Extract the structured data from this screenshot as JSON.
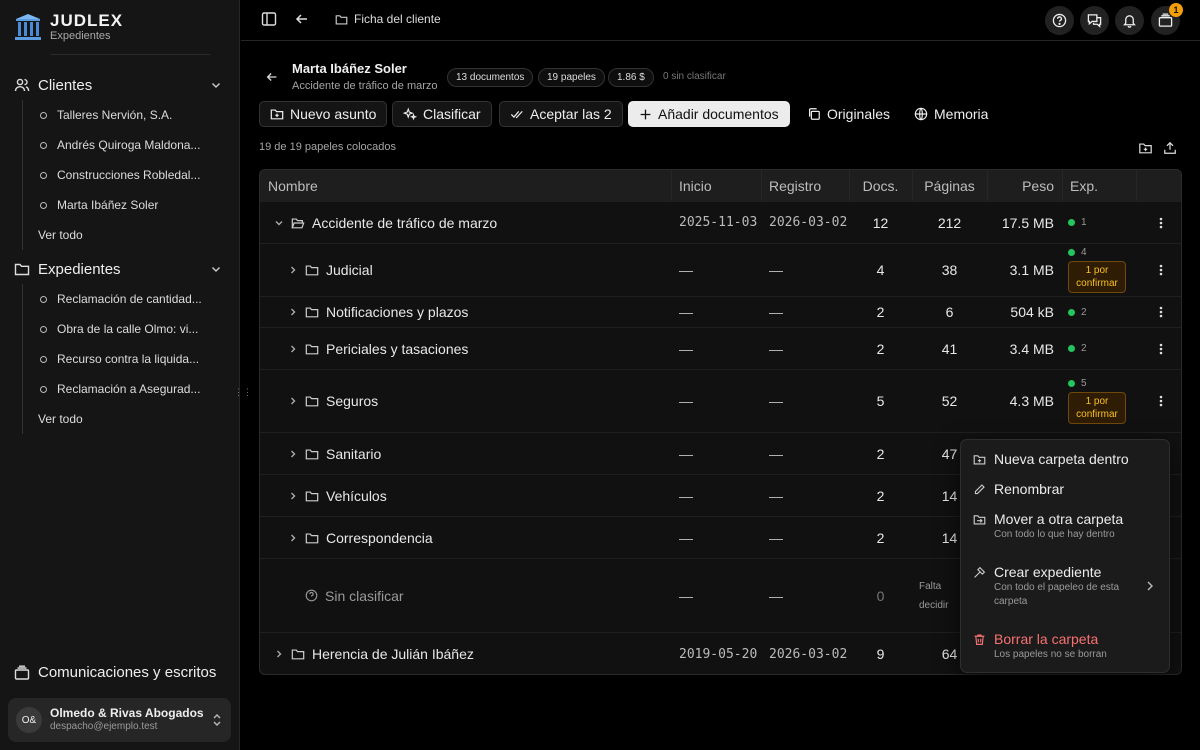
{
  "app": {
    "name": "JUDLEX",
    "subtitle": "Expedientes"
  },
  "sidebar": {
    "clients_title": "Clientes",
    "clients": [
      "Talleres Nervión, S.A.",
      "Andrés Quiroga Maldona...",
      "Construcciones Robledal...",
      "Marta Ibáñez Soler"
    ],
    "clients_all": "Ver todo",
    "files_title": "Expedientes",
    "files": [
      "Reclamación de cantidad...",
      "Obra de la calle Olmo: vi...",
      "Recurso contra la liquida...",
      "Reclamación a Asegurad..."
    ],
    "files_all": "Ver todo",
    "comms": "Comunicaciones y escritos",
    "account": {
      "initials": "O&",
      "name": "Olmedo & Rivas Abogados",
      "email": "despacho@ejemplo.test"
    }
  },
  "topbar": {
    "breadcrumb": "Ficha del cliente",
    "notifications_badge": "1"
  },
  "header": {
    "name": "Marta Ibáñez Soler",
    "subtitle": "Accidente de tráfico de marzo",
    "pills": [
      "13 documentos",
      "19 papeles",
      "1.86 $"
    ],
    "unclassified": "0 sin clasificar"
  },
  "actions": {
    "new_matter": "Nuevo asunto",
    "classify": "Clasificar",
    "accept": "Aceptar las 2",
    "add_docs": "Añadir documentos",
    "originals": "Originales",
    "memory": "Memoria"
  },
  "status": "19 de 19 papeles colocados",
  "table": {
    "columns": {
      "name": "Nombre",
      "start": "Inicio",
      "registry": "Registro",
      "docs": "Docs.",
      "pages": "Páginas",
      "size": "Peso",
      "exp": "Exp."
    },
    "rows": [
      {
        "name": "Accidente de tráfico de marzo",
        "start": "2025-11-03",
        "registry": "2026-03-02",
        "docs": "12",
        "pages": "212",
        "size": "17.5 MB",
        "exp": "1",
        "pending": ""
      },
      {
        "name": "Judicial",
        "start": "—",
        "registry": "—",
        "docs": "4",
        "pages": "38",
        "size": "3.1 MB",
        "exp": "4",
        "pending": "1 por confirmar"
      },
      {
        "name": "Notificaciones y plazos",
        "start": "—",
        "registry": "—",
        "docs": "2",
        "pages": "6",
        "size": "504 kB",
        "exp": "2",
        "pending": ""
      },
      {
        "name": "Periciales y tasaciones",
        "start": "—",
        "registry": "—",
        "docs": "2",
        "pages": "41",
        "size": "3.4 MB",
        "exp": "2",
        "pending": ""
      },
      {
        "name": "Seguros",
        "start": "—",
        "registry": "—",
        "docs": "5",
        "pages": "52",
        "size": "4.3 MB",
        "exp": "5",
        "pending": "1 por confirmar"
      },
      {
        "name": "Sanitario",
        "start": "—",
        "registry": "—",
        "docs": "2",
        "pages": "47",
        "size": "",
        "exp": "",
        "pending": ""
      },
      {
        "name": "Vehículos",
        "start": "—",
        "registry": "—",
        "docs": "2",
        "pages": "14",
        "size": "",
        "exp": "",
        "pending": ""
      },
      {
        "name": "Correspondencia",
        "start": "—",
        "registry": "—",
        "docs": "2",
        "pages": "14",
        "size": "",
        "exp": "",
        "pending": ""
      },
      {
        "name": "Sin clasificar",
        "start": "—",
        "registry": "—",
        "docs": "0",
        "pages": "Falta decidir",
        "size": "",
        "exp": "",
        "pending": ""
      },
      {
        "name": "Herencia de Julián Ibáñez",
        "start": "2019-05-20",
        "registry": "2026-03-02",
        "docs": "9",
        "pages": "64",
        "size": "",
        "exp": "",
        "pending": ""
      }
    ]
  },
  "context_menu": {
    "new_folder": "Nueva carpeta dentro",
    "rename": "Renombrar",
    "move": "Mover a otra carpeta",
    "move_sub": "Con todo lo que hay dentro",
    "create": "Crear expediente",
    "create_sub": "Con todo el papeleo de esta carpeta",
    "delete": "Borrar la carpeta",
    "delete_sub": "Los papeles no se borran"
  },
  "colors": {
    "accent_green": "#22c55e",
    "warning": "#f59e0b",
    "danger": "#f87171"
  }
}
